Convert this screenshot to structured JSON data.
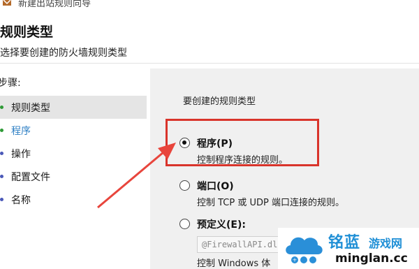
{
  "window": {
    "title": "新建出站规则向导",
    "icon": "firewall-wizard-icon"
  },
  "header": {
    "title": "规则类型",
    "subtitle": "选择要创建的防火墙规则类型"
  },
  "steps": {
    "heading": "步骤:",
    "items": [
      {
        "label": "规则类型",
        "color": "#2e9a36",
        "active": true
      },
      {
        "label": "程序",
        "color": "#2e9a36",
        "active": false
      },
      {
        "label": "操作",
        "color": "#4a58b8",
        "active": false
      },
      {
        "label": "配置文件",
        "color": "#4a58b8",
        "active": false
      },
      {
        "label": "名称",
        "color": "#4a58b8",
        "active": false
      }
    ]
  },
  "panel": {
    "heading": "要创建的规则类型",
    "options": [
      {
        "label": "程序(P)",
        "description": "控制程序连接的规则。",
        "checked": true
      },
      {
        "label": "端口(O)",
        "description": "控制 TCP 或 UDP 端口连接的规则。",
        "checked": false
      },
      {
        "label": "预定义(E):",
        "description": "控制 Windows 体",
        "checked": false
      }
    ],
    "predefined_value": "@FirewallAPI.dll,"
  },
  "annotation": {
    "highlight_color": "#d9342b"
  },
  "watermark": {
    "brand": "铭蓝",
    "tagline": "游戏网",
    "url": "minglan.cc",
    "brand_color": "#1f8fd6"
  }
}
